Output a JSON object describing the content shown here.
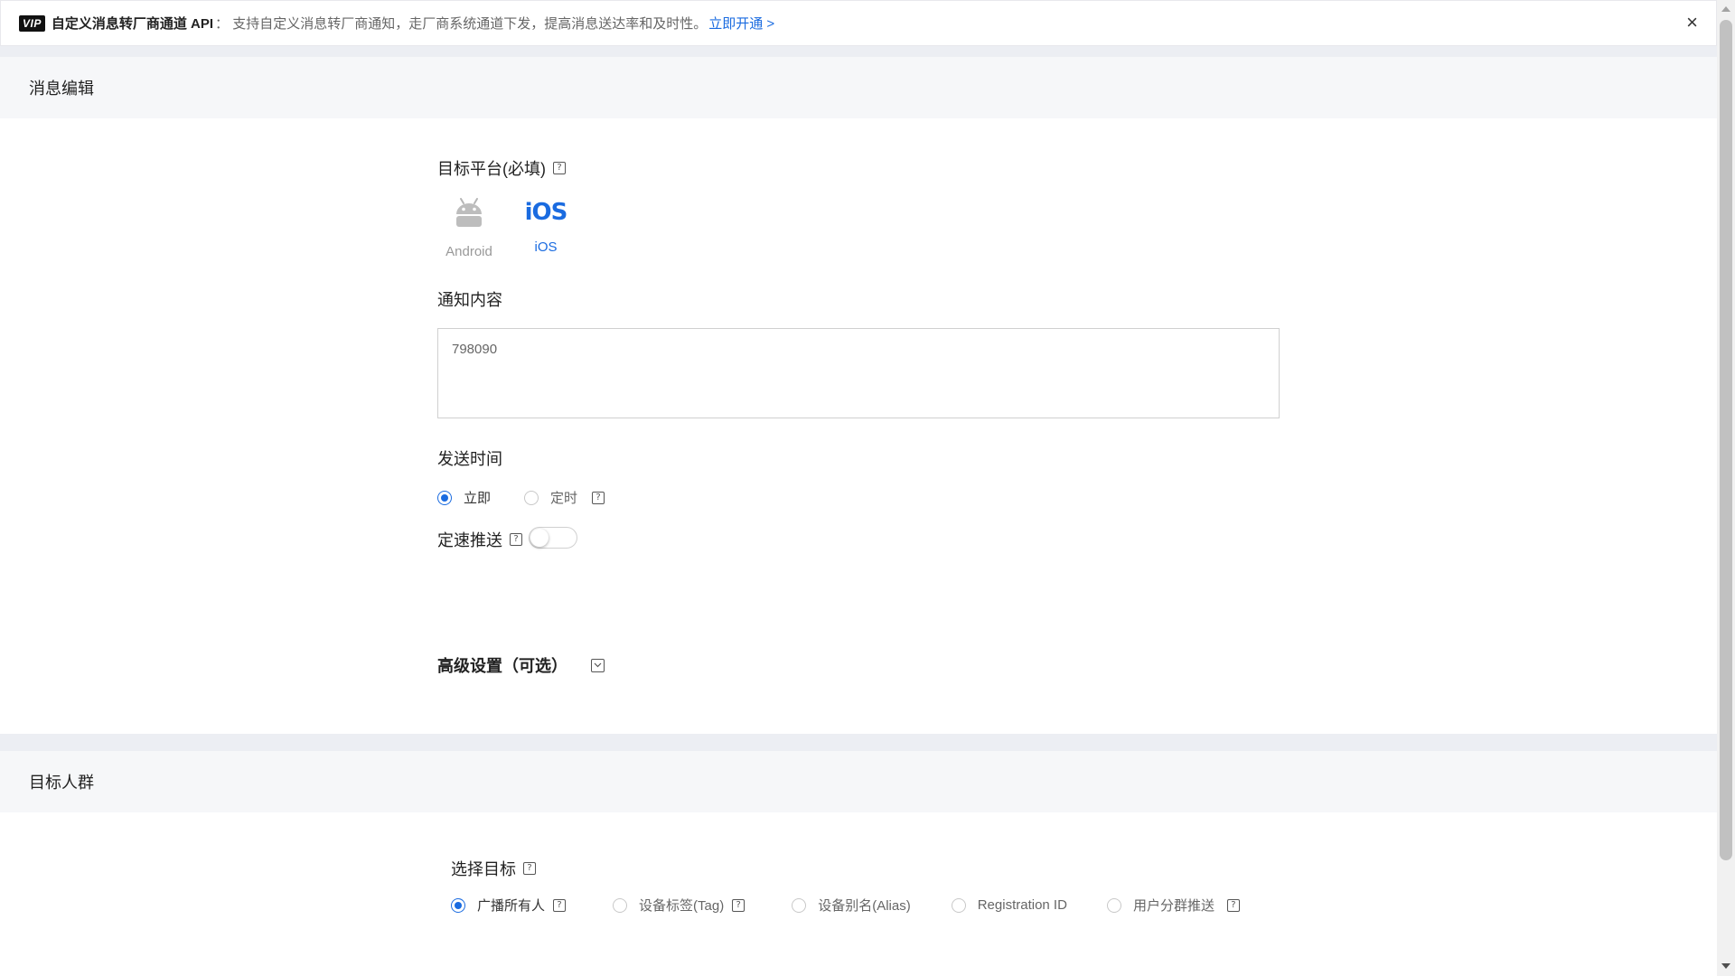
{
  "banner": {
    "vip_badge": "VIP",
    "title": "自定义消息转厂商通道 API",
    "description": "：  支持自定义消息转厂商通知，走厂商系统通道下发，提高消息送达率和及时性。",
    "link": "立即开通 >",
    "close_icon": "×"
  },
  "sections": {
    "message_edit": "消息编辑",
    "target_audience": "目标人群"
  },
  "platform": {
    "label": "目标平台(必填)",
    "options": [
      {
        "label": "Android",
        "icon": "android-icon",
        "selected": false
      },
      {
        "label": "iOS",
        "icon": "ios-icon",
        "logo_text": "iOS",
        "selected": true
      }
    ]
  },
  "content": {
    "label": "通知内容",
    "value": "798090"
  },
  "send_time": {
    "label": "发送时间",
    "options": [
      "立即",
      "定时"
    ],
    "selected": "立即"
  },
  "rate_push": {
    "label": "定速推送",
    "enabled": false
  },
  "advanced": {
    "label": "高级设置（可选）"
  },
  "target": {
    "label": "选择目标",
    "options": [
      "广播所有人",
      "设备标签(Tag)",
      "设备别名(Alias)",
      "Registration ID",
      "用户分群推送"
    ],
    "selected": "广播所有人"
  },
  "help_glyph": "?",
  "colors": {
    "accent": "#1a6be0",
    "section_bg": "#f6f7f9",
    "divider_bg": "#eceef3"
  }
}
